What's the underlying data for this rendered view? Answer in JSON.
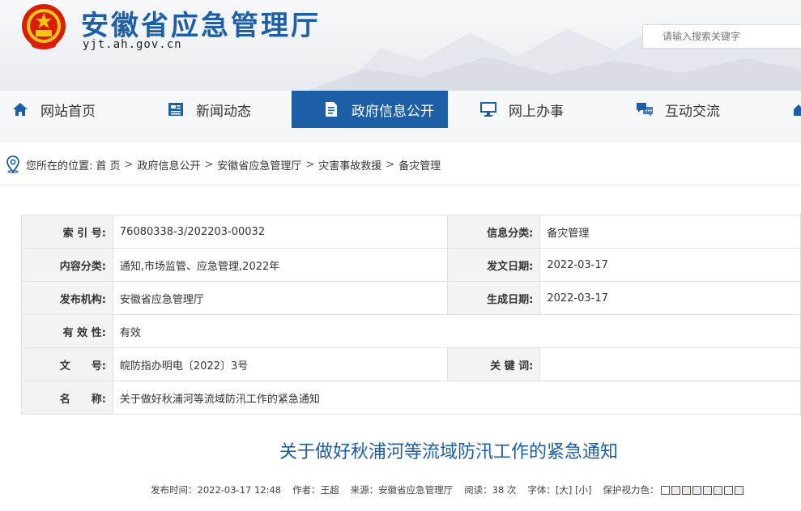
{
  "site": {
    "name": "安徽省应急管理厅",
    "domain": "yjt.ah.gov.cn",
    "search_placeholder": "请输入搜索关键字"
  },
  "nav": [
    {
      "label": "网站首页",
      "icon": "home-icon"
    },
    {
      "label": "新闻动态",
      "icon": "news-icon"
    },
    {
      "label": "政府信息公开",
      "icon": "document-icon",
      "active": true
    },
    {
      "label": "网上办事",
      "icon": "monitor-icon"
    },
    {
      "label": "互动交流",
      "icon": "chat-icon"
    }
  ],
  "breadcrumb": {
    "prefix": "您所在的位置:",
    "items": [
      "首 页",
      "政府信息公开",
      "安徽省应急管理厅",
      "灾害事故救援",
      "备灾管理"
    ],
    "separator": ">"
  },
  "meta": {
    "index_label": "索 引 号:",
    "index_value": "76080338-3/202203-00032",
    "category_label": "信息分类:",
    "category_value": "备灾管理",
    "content_label": "内容分类:",
    "content_value": "通知,市场监管、应急管理,2022年",
    "issue_date_label": "发文日期:",
    "issue_date_value": "2022-03-17",
    "publisher_label": "发布机构:",
    "publisher_value": "安徽省应急管理厅",
    "effective_date_label": "生成日期:",
    "effective_date_value": "2022-03-17",
    "validity_label": "有 效 性:",
    "validity_value": "有效",
    "doc_no_label": "文　　号:",
    "doc_no_value": "皖防指办明电〔2022〕3号",
    "keywords_label": "关 键 词:",
    "keywords_value": "",
    "name_label": "名　　称:",
    "name_value": "关于做好秋浦河等流域防汛工作的紧急通知"
  },
  "article": {
    "title": "关于做好秋浦河等流域防汛工作的紧急通知",
    "published": "发布时间：2022-03-17 12:48",
    "author": "作者：王超",
    "source": "来源：安徽省应急管理厅",
    "reads": "阅读：38 次",
    "font_size": "字体：[大] [小]",
    "eye_care": "保护视力色："
  },
  "eye_care_colors": [
    "#ffffff",
    "#f6e8e8",
    "#eee8d8",
    "#ece4f0",
    "#e8f0e0",
    "#e4ecf4",
    "#f0f0e4",
    "#ececec"
  ],
  "colors": {
    "brand": "#1c5fa6",
    "header_bg": "#eef1f4"
  }
}
